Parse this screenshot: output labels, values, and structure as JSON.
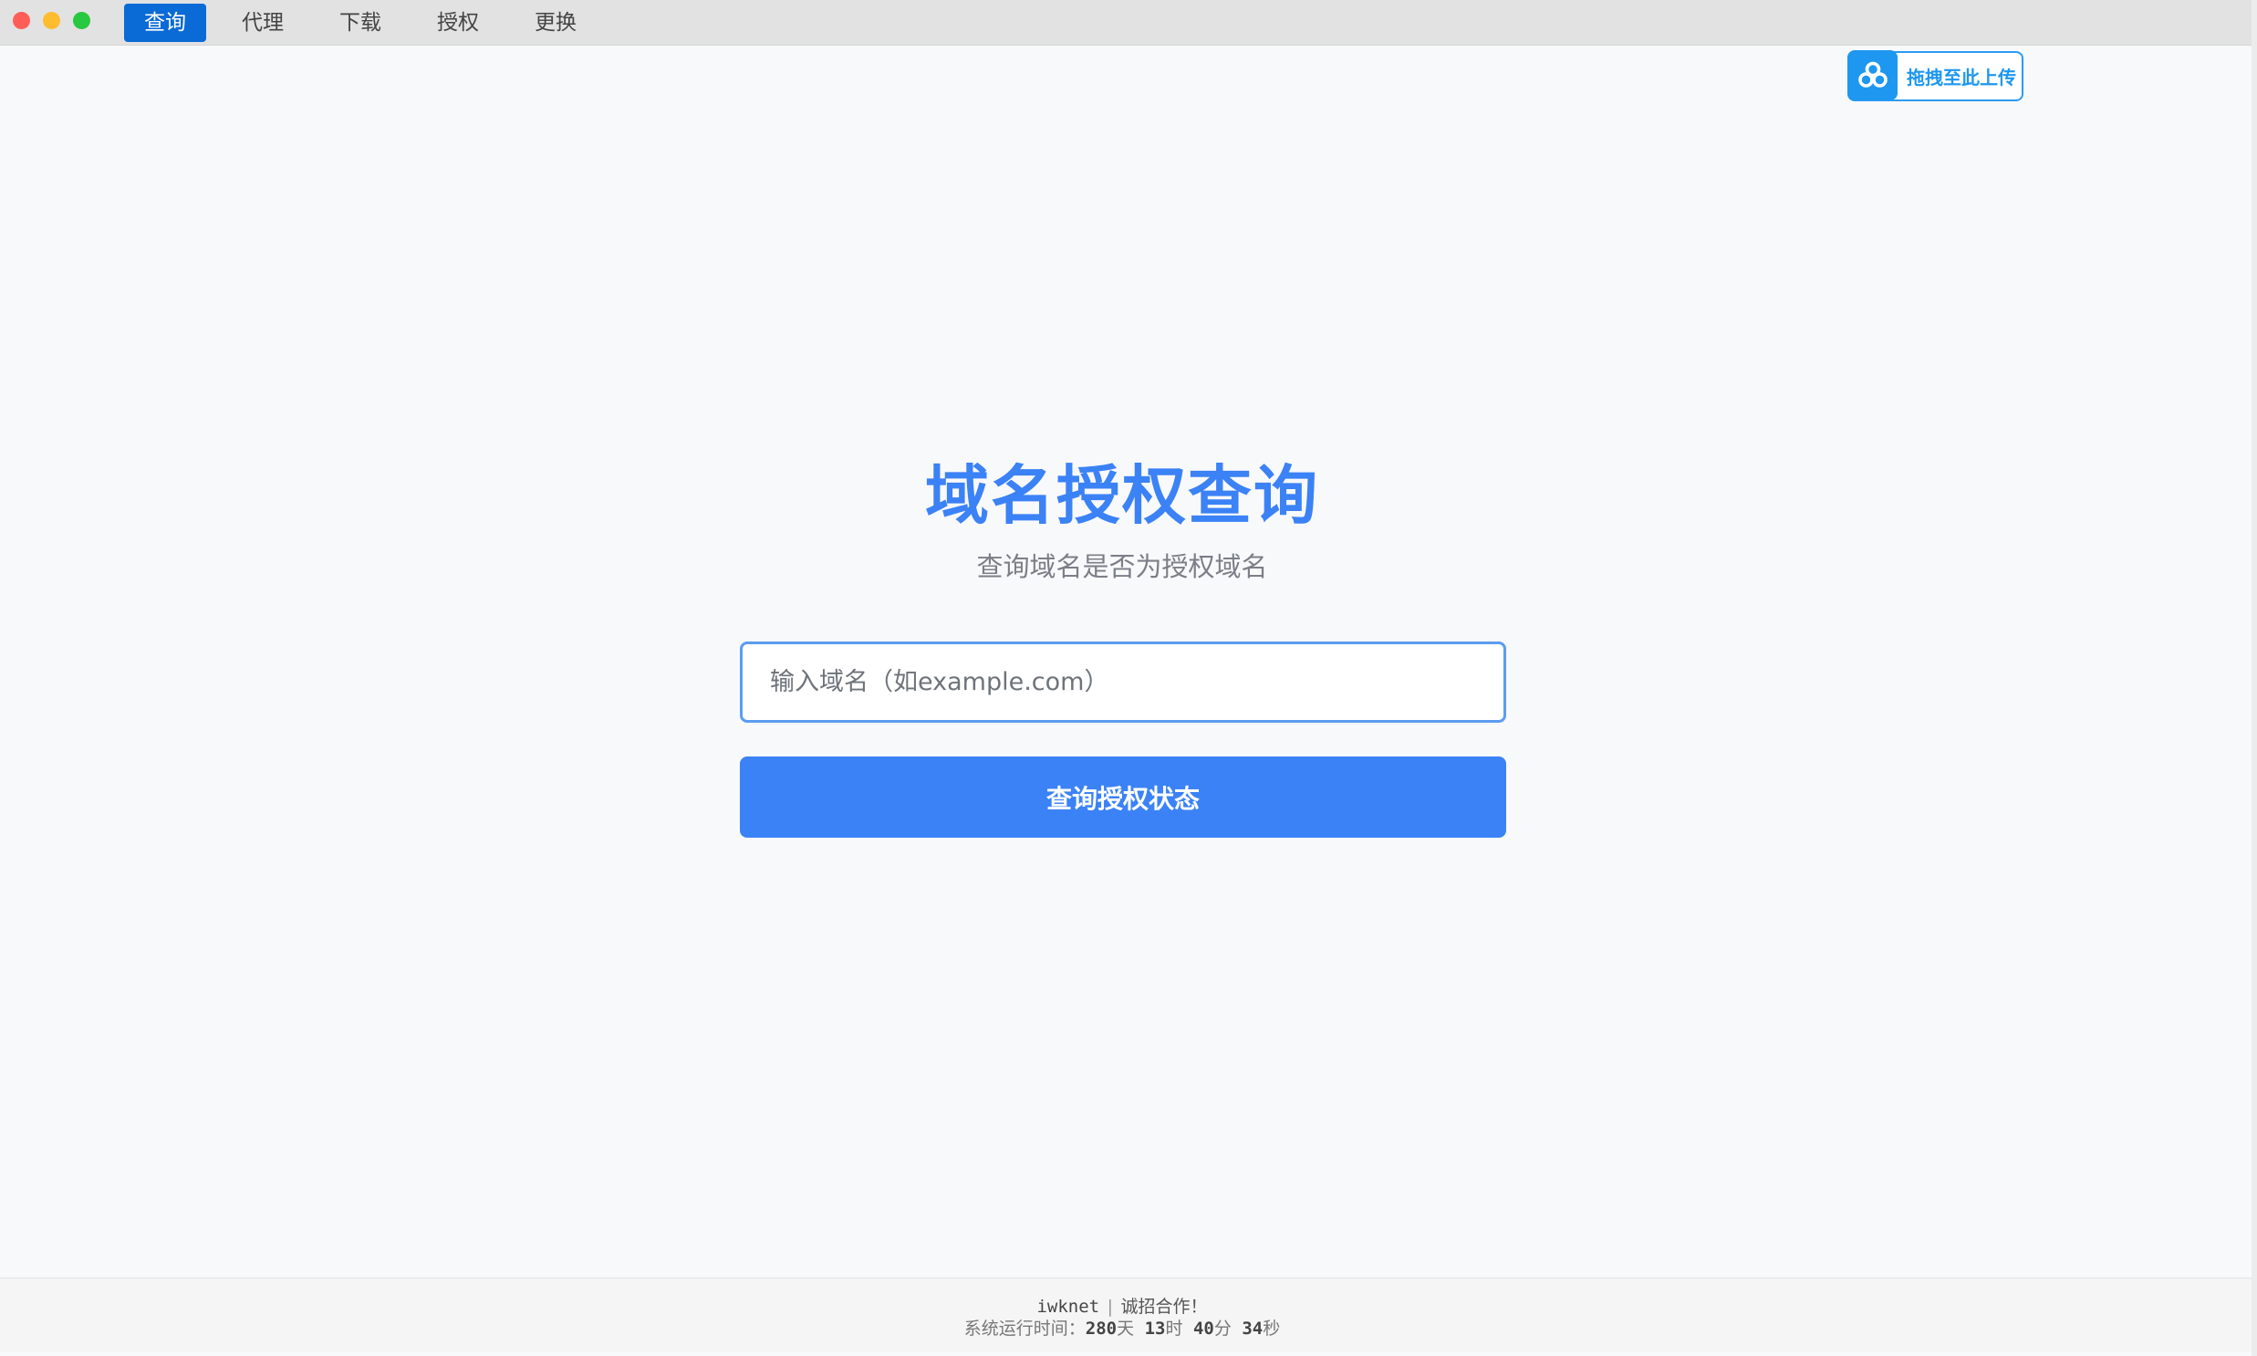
{
  "tabs": [
    {
      "label": "查询",
      "active": true
    },
    {
      "label": "代理",
      "active": false
    },
    {
      "label": "下载",
      "active": false
    },
    {
      "label": "授权",
      "active": false
    },
    {
      "label": "更换",
      "active": false
    }
  ],
  "upload_badge": {
    "icon": "cloud-icon",
    "label": "拖拽至此上传"
  },
  "main": {
    "title": "域名授权查询",
    "subtitle": "查询域名是否为授权域名",
    "input": {
      "placeholder": "输入域名（如example.com）",
      "value": ""
    },
    "button_label": "查询授权状态"
  },
  "footer": {
    "brand": "iwknet",
    "separator": "|",
    "slogan": "诚招合作！",
    "uptime_label": "系统运行时间：",
    "days": "280",
    "days_unit": "天",
    "hours": "13",
    "hours_unit": "时",
    "minutes": "40",
    "minutes_unit": "分",
    "seconds": "34",
    "seconds_unit": "秒"
  },
  "colors": {
    "accent": "#3b82f6",
    "tab_active": "#0a6ad6",
    "upload_blue": "#1e97f0",
    "traffic_red": "#fd5f57",
    "traffic_yellow": "#febc2e",
    "traffic_green": "#28c840"
  }
}
